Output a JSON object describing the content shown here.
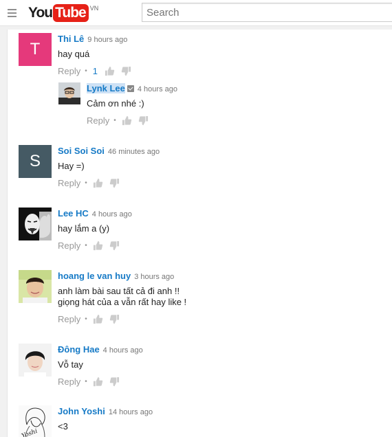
{
  "header": {
    "logo_you": "You",
    "logo_tube": "Tube",
    "region": "VN",
    "search_placeholder": "Search"
  },
  "labels": {
    "reply": "Reply",
    "dot": "•"
  },
  "comments": [
    {
      "author": "Thi Lê",
      "time": "9 hours ago",
      "text": "hay quá",
      "likes": "1",
      "avatar_letter": "T",
      "avatar_color": "#e5397b"
    },
    {
      "author": "Soi Soi Soi",
      "time": "46 minutes ago",
      "text": "Hay =)",
      "avatar_letter": "S",
      "avatar_color": "#455a64"
    },
    {
      "author": "Lee HC",
      "time": "4 hours ago",
      "text": "hay lắm a (y)"
    },
    {
      "author": "hoang le van huy",
      "time": "3 hours ago",
      "text_line1": "anh làm bài sau tất cả đi anh !!",
      "text_line2": "giọng hát của a vẫn rất hay like !"
    },
    {
      "author": "Đông Hae",
      "time": "4 hours ago",
      "text": "Vỗ tay"
    },
    {
      "author": "John Yoshi",
      "time": "14 hours ago",
      "text": "<3",
      "avatar_text": "Yoshi"
    }
  ],
  "reply": {
    "author": "Lynk Lee",
    "time": "4 hours ago",
    "text": "Cảm ơn nhé :)"
  }
}
